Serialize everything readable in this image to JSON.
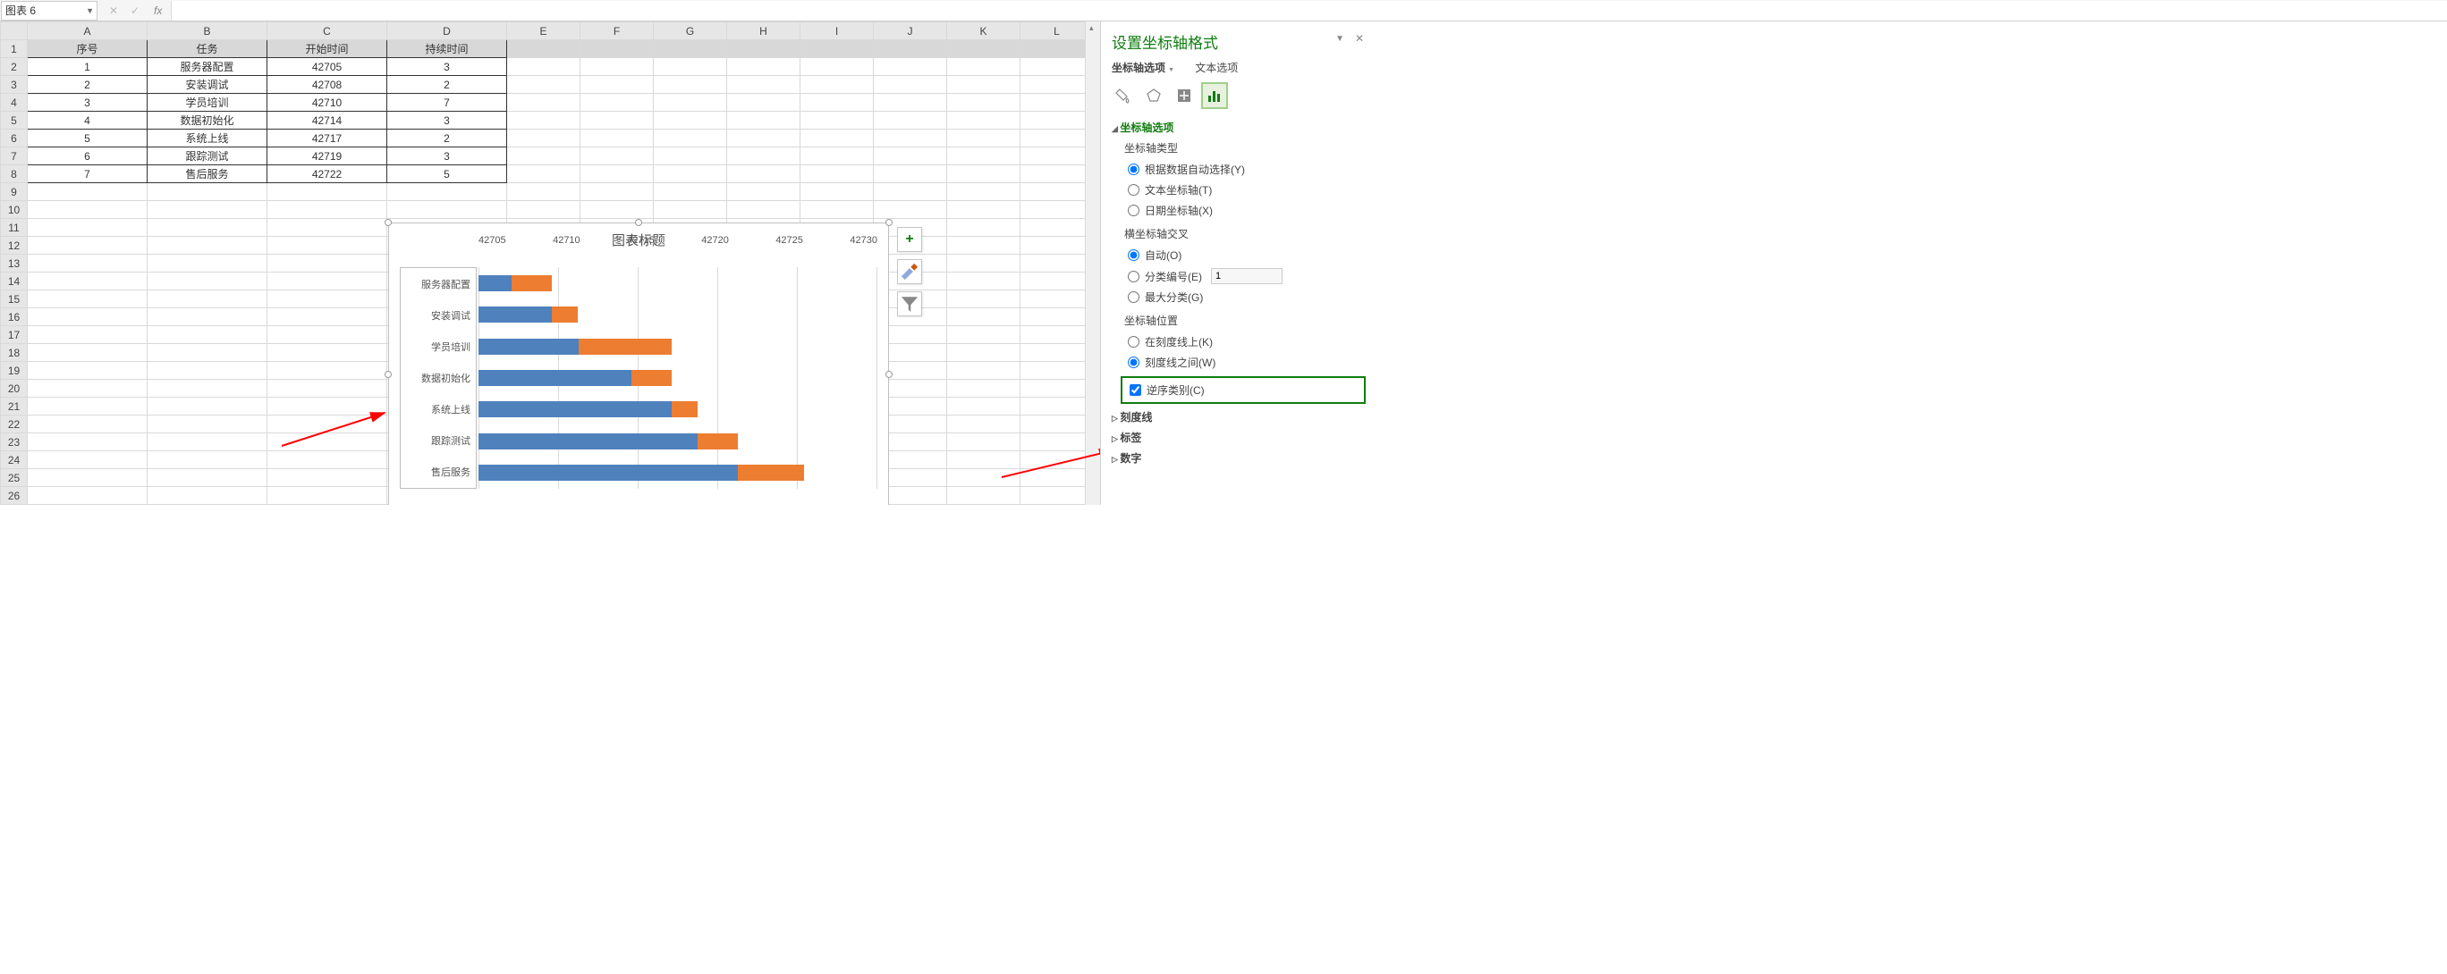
{
  "name_box": "图表 6",
  "fx": "fx",
  "columns": [
    "A",
    "B",
    "C",
    "D",
    "E",
    "F",
    "G",
    "H",
    "I",
    "J",
    "K",
    "L"
  ],
  "rows": [
    "1",
    "2",
    "3",
    "4",
    "5",
    "6",
    "7",
    "8",
    "9",
    "10",
    "11",
    "12",
    "13",
    "14",
    "15",
    "16",
    "17",
    "18",
    "19",
    "20",
    "21",
    "22",
    "23",
    "24",
    "25",
    "26"
  ],
  "table": {
    "headers": [
      "序号",
      "任务",
      "开始时间",
      "持续时间"
    ],
    "data": [
      [
        "1",
        "服务器配置",
        "42705",
        "3"
      ],
      [
        "2",
        "安装调试",
        "42708",
        "2"
      ],
      [
        "3",
        "学员培训",
        "42710",
        "7"
      ],
      [
        "4",
        "数据初始化",
        "42714",
        "3"
      ],
      [
        "5",
        "系统上线",
        "42717",
        "2"
      ],
      [
        "6",
        "跟踪测试",
        "42719",
        "3"
      ],
      [
        "7",
        "售后服务",
        "42722",
        "5"
      ]
    ]
  },
  "chart_data": {
    "type": "bar",
    "title": "图表标题",
    "categories": [
      "服务器配置",
      "安装调试",
      "学员培训",
      "数据初始化",
      "系统上线",
      "跟踪测试",
      "售后服务"
    ],
    "series": [
      {
        "name": "开始时间",
        "values": [
          42705,
          42708,
          42710,
          42714,
          42717,
          42719,
          42722
        ]
      },
      {
        "name": "持续时间",
        "values": [
          3,
          2,
          7,
          3,
          2,
          3,
          5
        ]
      }
    ],
    "x_ticks": [
      "42705",
      "42710",
      "42715",
      "42720",
      "42725",
      "42730"
    ],
    "x_min": 42702.5,
    "x_max": 42732.5
  },
  "chart_side_buttons": {
    "add": "+",
    "brush": "✎",
    "filter": "▼"
  },
  "panel": {
    "title": "设置坐标轴格式",
    "tabs": {
      "axis": "坐标轴选项",
      "text": "文本选项"
    },
    "section_axis_options": "坐标轴选项",
    "axis_type_label": "坐标轴类型",
    "axis_type_auto": "根据数据自动选择(Y)",
    "axis_type_text": "文本坐标轴(T)",
    "axis_type_date": "日期坐标轴(X)",
    "cross_label": "横坐标轴交叉",
    "cross_auto": "自动(O)",
    "cross_cat": "分类编号(E)",
    "cross_cat_val": "1",
    "cross_max": "最大分类(G)",
    "pos_label": "坐标轴位置",
    "pos_on_tick": "在刻度线上(K)",
    "pos_between": "刻度线之间(W)",
    "reverse": "逆序类别(C)",
    "sect_tick": "刻度线",
    "sect_label": "标签",
    "sect_number": "数字"
  }
}
